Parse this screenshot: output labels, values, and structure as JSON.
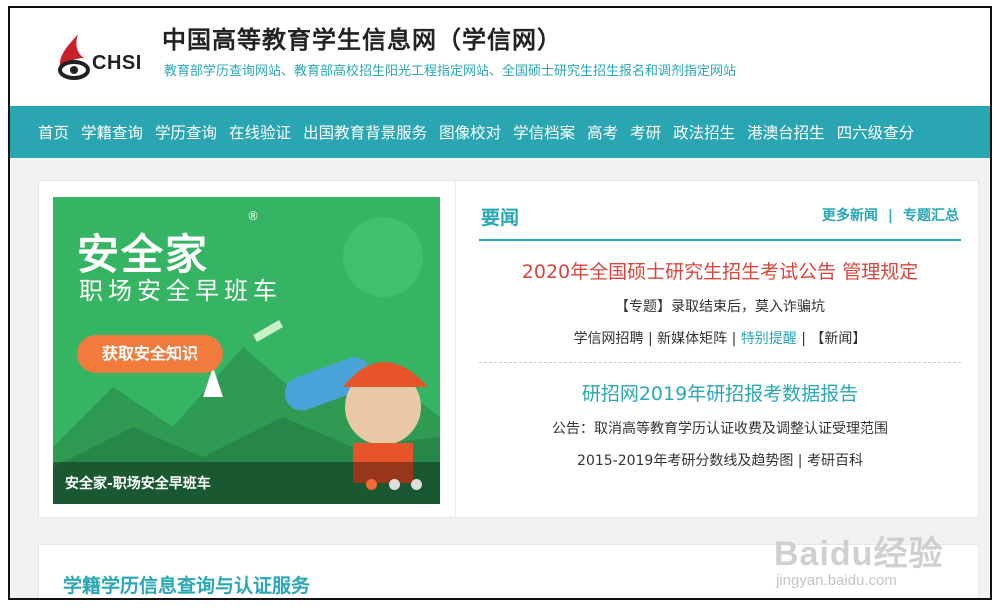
{
  "header": {
    "logo_text": "CHSI",
    "title": "中国高等教育学生信息网（学信网）",
    "subtitle": "教育部学历查询网站、教育部高校招生阳光工程指定网站、全国硕士研究生招生报名和调剂指定网站"
  },
  "nav": {
    "items": [
      "首页",
      "学籍查询",
      "学历查询",
      "在线验证",
      "出国教育背景服务",
      "图像校对",
      "学信档案",
      "高考",
      "考研",
      "政法招生",
      "港澳台招生",
      "四六级查分"
    ]
  },
  "banner": {
    "title": "安全家",
    "registered": "®",
    "slogan": "职场安全早班车",
    "button": "获取安全知识",
    "caption": "安全家-职场安全早班车"
  },
  "news": {
    "title": "要闻",
    "more_news": "更多新闻",
    "separator": "|",
    "topics": "专题汇总",
    "headline1": "2020年全国硕士研究生招生考试公告 管理规定",
    "line1": "【专题】录取结束后，莫入诈骗坑",
    "line2_a": "学信网招聘 | 新媒体矩阵 | ",
    "line2_hl": "特别提醒",
    "line2_b": " | 【新闻】",
    "headline2": "研招网2019年研招报考数据报告",
    "line3": "公告：取消高等教育学历认证收费及调整认证受理范围",
    "line4": "2015-2019年考研分数线及趋势图 | 考研百科"
  },
  "section": {
    "title": "学籍学历信息查询与认证服务"
  },
  "watermark": {
    "main": "Baidu经验",
    "url": "jingyan.baidu.com"
  },
  "colors": {
    "accent": "#29a6b2",
    "headline_red": "#d9463b",
    "banner_green": "#35b463",
    "banner_orange": "#f07b3c"
  }
}
